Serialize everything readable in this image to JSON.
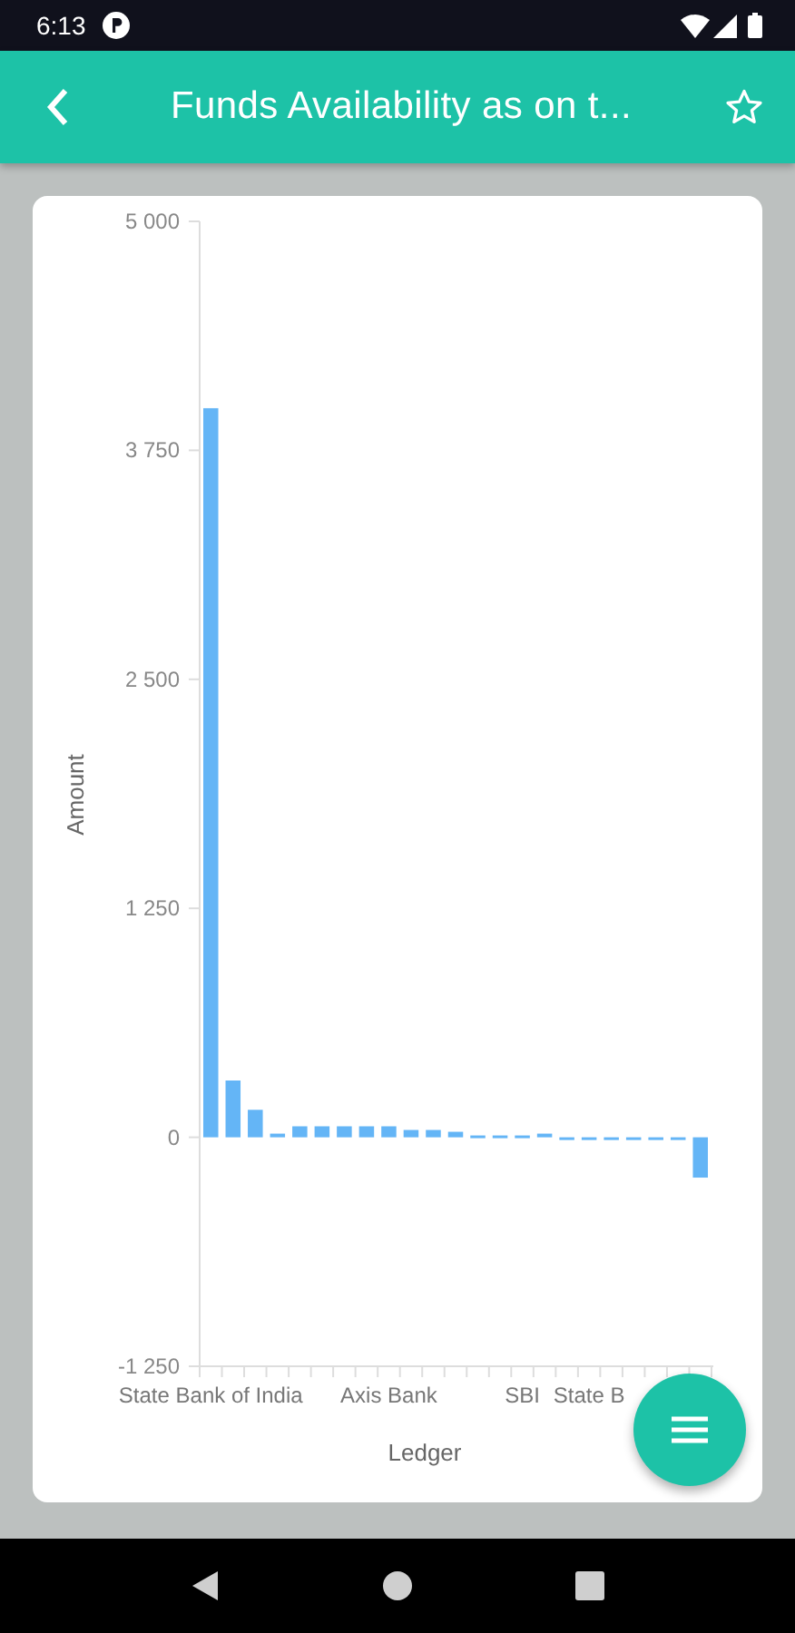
{
  "status_bar": {
    "time": "6:13"
  },
  "app_bar": {
    "title": "Funds Availability as on t..."
  },
  "chart": {
    "chart_data": {
      "type": "bar",
      "xlabel": "Ledger",
      "ylabel": "Amount",
      "categories": [
        "State Bank of India",
        null,
        null,
        null,
        null,
        null,
        null,
        null,
        "Axis Bank",
        null,
        null,
        null,
        null,
        null,
        "SBI",
        null,
        null,
        "State B",
        null,
        null,
        null,
        null,
        null
      ],
      "series": [
        {
          "color": "#64b5f6",
          "values": [
            3980,
            310,
            150,
            20,
            60,
            60,
            60,
            60,
            60,
            40,
            40,
            30,
            10,
            10,
            10,
            20,
            0,
            0,
            0,
            0,
            0,
            0,
            -220
          ]
        }
      ],
      "ylim": [
        -1250,
        5000
      ],
      "yticks": [
        {
          "value": -1250,
          "label": "-1 250"
        },
        {
          "value": 0,
          "label": "0"
        },
        {
          "value": 1250,
          "label": "1 250"
        },
        {
          "value": 2500,
          "label": "2 500"
        },
        {
          "value": 3750,
          "label": "3 750"
        },
        {
          "value": 5000,
          "label": "5 000"
        }
      ]
    }
  }
}
